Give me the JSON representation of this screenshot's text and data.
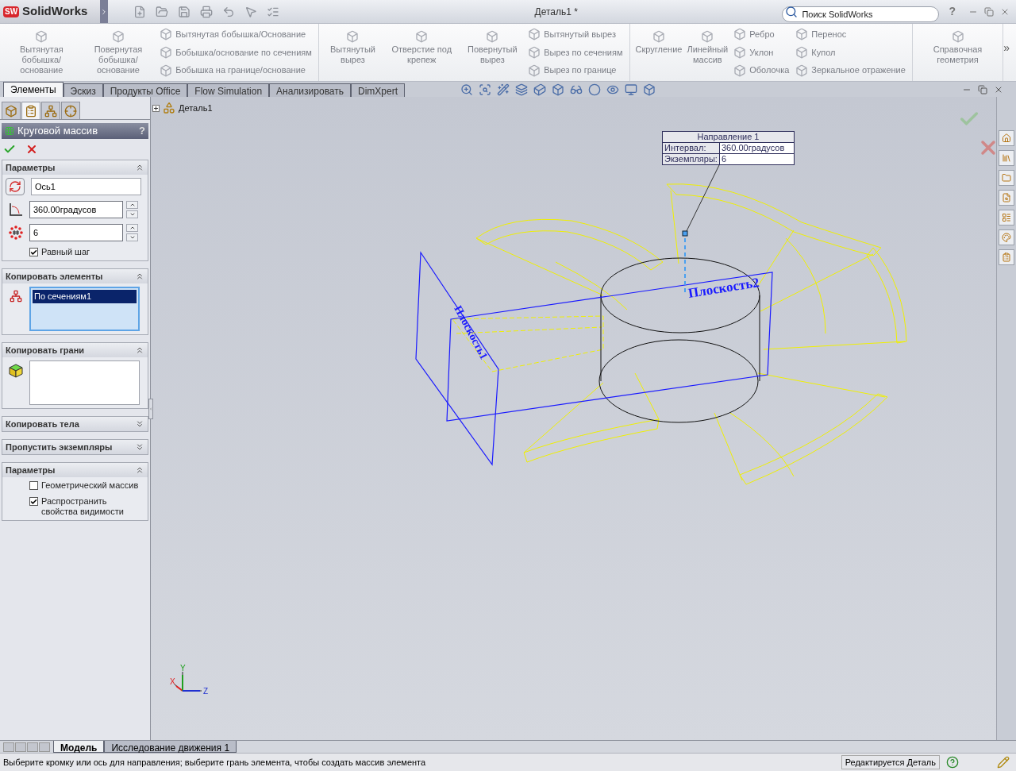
{
  "titlebar": {
    "logo_prefix": "SW",
    "logo": "SolidWorks",
    "title": "Деталь1 *",
    "search": {
      "placeholder": "Поиск SolidWorks"
    },
    "help": "?"
  },
  "ribbon": {
    "groups": [
      {
        "large": [
          "Вытянутая бобышка/основание",
          "Повернутая бобышка/основание"
        ],
        "small": [
          [
            "Вытянутая бобышка/Основание",
            "Бобышка/основание по сечениям",
            "Бобышка на границе/основание"
          ]
        ]
      },
      {
        "large": [
          "Вытянутый вырез",
          "Отверстие под крепеж",
          "Повернутый вырез"
        ],
        "small": [
          [
            "Вытянутый вырез",
            "Вырез по сечениям",
            "Вырез по границе"
          ]
        ]
      },
      {
        "large": [
          "Скругление",
          "Линейный массив"
        ],
        "small": [
          [
            "Ребро",
            "Уклон",
            "Оболочка"
          ],
          [
            "Перенос",
            "Купол",
            "Зеркальное отражение"
          ]
        ]
      },
      {
        "large": [
          "Справочная геометрия"
        ]
      }
    ],
    "more": "»"
  },
  "tabs": [
    {
      "label": "Элементы",
      "selected": true
    },
    {
      "label": "Эскиз",
      "selected": false
    },
    {
      "label": "Продукты Office",
      "selected": false
    },
    {
      "label": "Flow Simulation",
      "selected": false
    },
    {
      "label": "Анализировать",
      "selected": false
    },
    {
      "label": "DimXpert",
      "selected": false
    }
  ],
  "panel": {
    "tabs": [
      {
        "selected": false
      },
      {
        "selected": true
      },
      {
        "selected": false
      },
      {
        "selected": false
      }
    ],
    "title": "Круговой массив",
    "help": "?",
    "sections": [
      {
        "title": "Параметры",
        "expanded": true,
        "rows": [
          {
            "kind": "axis",
            "value": "Ось1"
          },
          {
            "kind": "angle",
            "value": "360.00градусов"
          },
          {
            "kind": "count",
            "value": "6"
          },
          {
            "kind": "checkbox",
            "label": "Равный шаг",
            "checked": true
          }
        ]
      },
      {
        "title": "Копировать элементы",
        "expanded": true,
        "rows": [
          {
            "kind": "feature-list",
            "items": [
              {
                "label": "По сечениям1",
                "selected": true
              }
            ]
          }
        ]
      },
      {
        "title": "Копировать грани",
        "expanded": true,
        "rows": [
          {
            "kind": "face-list",
            "items": []
          }
        ]
      },
      {
        "title": "Копировать тела",
        "expanded": false
      },
      {
        "title": "Пропустить экземпляры",
        "expanded": false
      },
      {
        "title": "Параметры",
        "expanded": true,
        "rows": [
          {
            "kind": "checkbox",
            "label": "Геометрический массив",
            "checked": false
          },
          {
            "kind": "checkbox",
            "label": "Распространить свойства видимости",
            "checked": true
          }
        ]
      }
    ]
  },
  "viewport": {
    "tree_root": "Деталь1",
    "callout": {
      "title": "Направление 1",
      "rows": [
        {
          "label": "Интервал:",
          "value": "360.00градусов"
        },
        {
          "label": "Экземпляры:",
          "value": "6"
        }
      ]
    },
    "plane_labels": [
      "Плоскость2",
      "Плоскость1"
    ],
    "axes": [
      "X",
      "Y",
      "Z"
    ]
  },
  "bottom_tabs": [
    {
      "label": "Модель",
      "selected": true
    },
    {
      "label": "Исследование движения 1",
      "selected": false
    }
  ],
  "status": {
    "message": "Выберите кромку или ось для направления; выберите грань элемента, чтобы создать массив элемента",
    "mode": "Редактируется Деталь"
  }
}
